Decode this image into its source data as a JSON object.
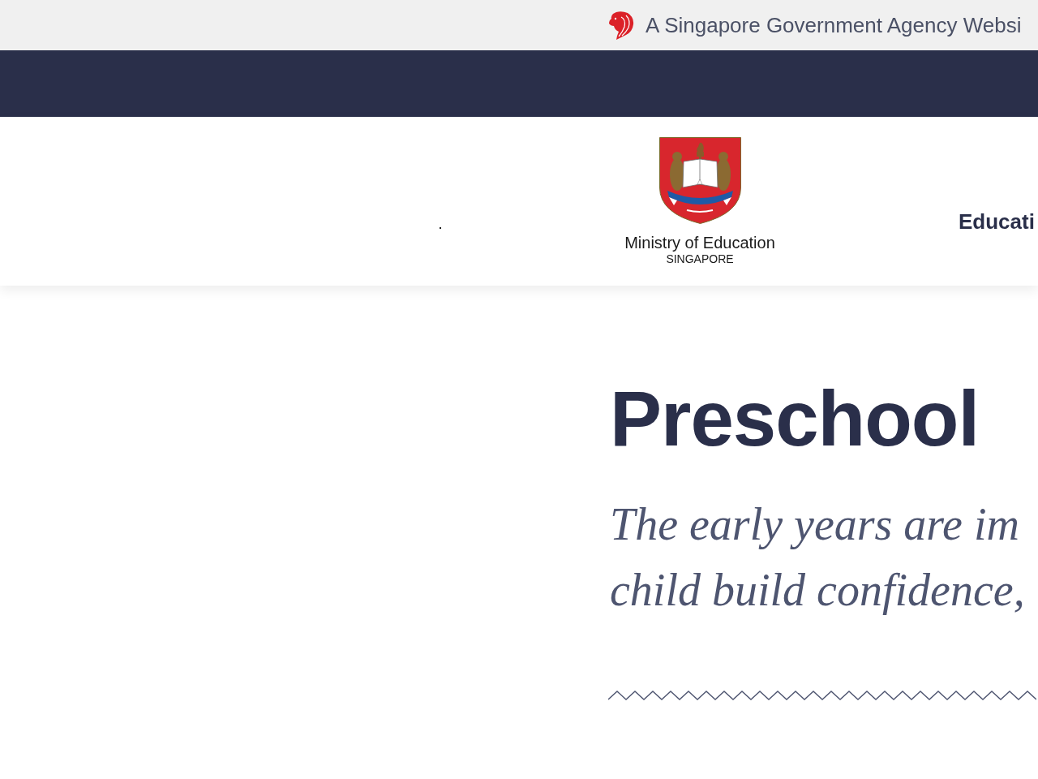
{
  "masthead": {
    "text": "A Singapore Government Agency Websi"
  },
  "header": {
    "logo": {
      "name": "Ministry of Education",
      "country": "SINGAPORE"
    },
    "nav": [
      {
        "label": "Educati"
      }
    ]
  },
  "hero": {
    "title": "Preschool",
    "intro": {
      "lines": [
        "The early years are im",
        "child build confidence,"
      ]
    }
  }
}
